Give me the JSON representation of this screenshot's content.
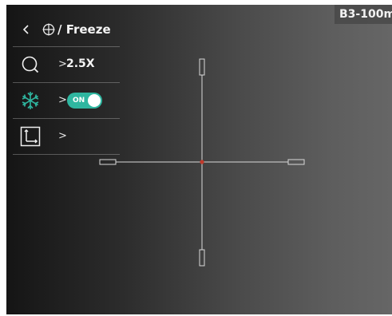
{
  "menu": {
    "breadcrumb": "/ Freeze",
    "zoom": {
      "chevron": ">",
      "value": "2.5X"
    },
    "freeze": {
      "chevron": ">",
      "toggle_label": "ON",
      "state": "on"
    },
    "position": {
      "chevron": ">"
    }
  },
  "profile_label": "B3-100m",
  "icons": {
    "back": "chevron-left-icon",
    "reticle": "crosshair-circle-icon",
    "zoom": "magnifier-icon",
    "freeze": "snowflake-icon",
    "position": "axis-adjust-icon"
  },
  "colors": {
    "accent": "#2fb6a0",
    "center_dot": "#c0392b"
  }
}
